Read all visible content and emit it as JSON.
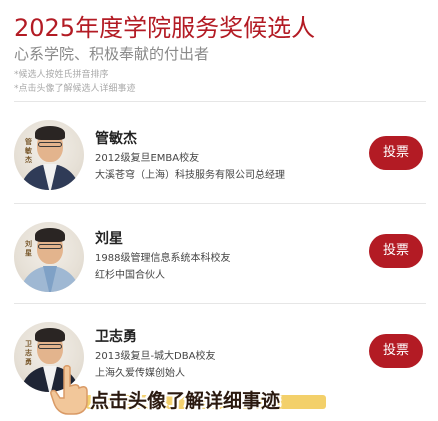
{
  "header": {
    "title": "2025年度学院服务奖候选人",
    "subtitle": "心系学院、积极奉献的付出者",
    "notes": [
      "*候选人按姓氏拼音排序",
      "*点击头像了解候选人详细事迹"
    ]
  },
  "candidates": [
    {
      "name": "管敏杰",
      "avatar_tag": "管敏杰",
      "line1": "2012级复旦EMBA校友",
      "line2": "大溪苍穹（上海）科技服务有限公司总经理",
      "vote_label": "投票"
    },
    {
      "name": "刘星",
      "avatar_tag": "刘星",
      "line1": "1988级管理信息系统本科校友",
      "line2": "红杉中国合伙人",
      "vote_label": "投票"
    },
    {
      "name": "卫志勇",
      "avatar_tag": "卫志勇",
      "line1": "2013级复旦-城大DBA校友",
      "line2": "上海久爱传媒创始人",
      "vote_label": "投票"
    }
  ],
  "overlay": {
    "hint": "点击头像了解详细事迹"
  },
  "colors": {
    "accent": "#b31b24",
    "hint_bar": "#f3d06a"
  }
}
